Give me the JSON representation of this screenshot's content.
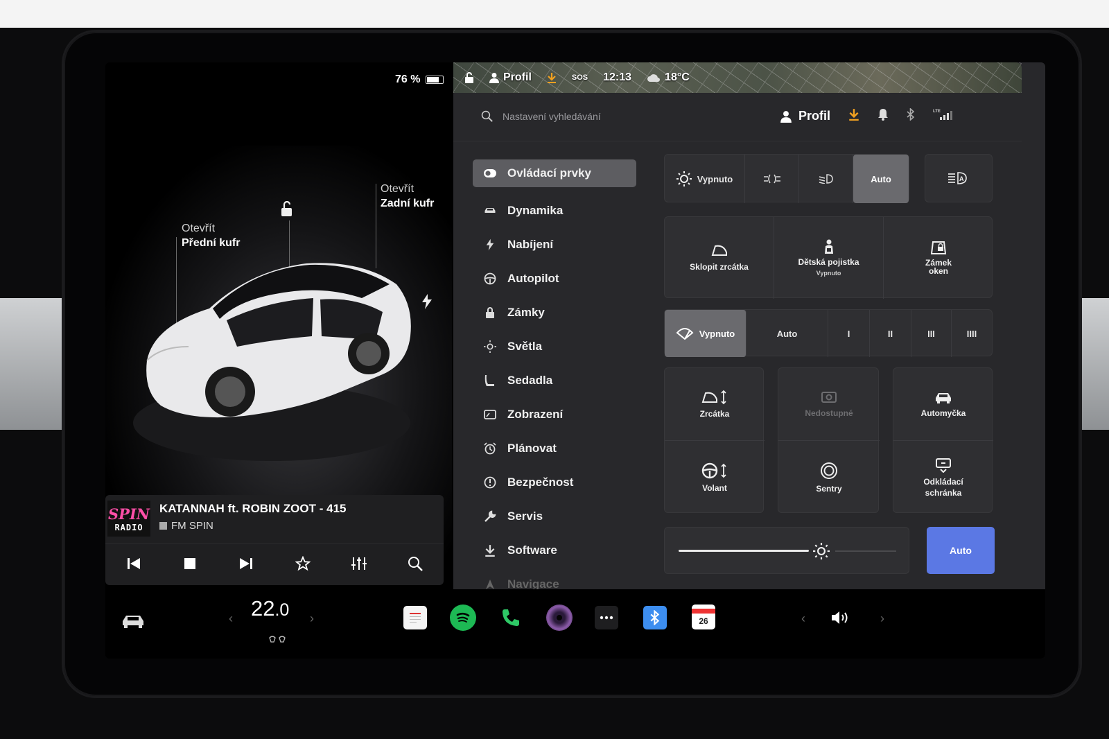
{
  "left": {
    "battery": "76 %",
    "battery_level": 0.76,
    "callout_front": {
      "line1": "Otevřít",
      "line2": "Přední kufr"
    },
    "callout_rear": {
      "line1": "Otevřít",
      "line2": "Zadní kufr"
    }
  },
  "media": {
    "logo_text": "SPIN",
    "logo_sub": "RADIO",
    "track": "KATANNAH ft. ROBIN ZOOT - 415",
    "station": "FM SPIN",
    "controls": [
      "prev-icon",
      "stop-icon",
      "next-icon",
      "favorite-icon",
      "equalizer-icon",
      "search-icon"
    ]
  },
  "statusbar": {
    "profile": "Profil",
    "sos": "SOS",
    "time": "12:13",
    "temperature": "18°C"
  },
  "topbar": {
    "search_placeholder": "Nastavení vyhledávání",
    "profile": "Profil"
  },
  "nav": {
    "items": [
      {
        "label": "Ovládací prvky",
        "icon": "toggle-icon",
        "active": true
      },
      {
        "label": "Dynamika",
        "icon": "car-icon"
      },
      {
        "label": "Nabíjení",
        "icon": "bolt-icon"
      },
      {
        "label": "Autopilot",
        "icon": "steering-wheel-icon"
      },
      {
        "label": "Zámky",
        "icon": "lock-icon"
      },
      {
        "label": "Světla",
        "icon": "sun-icon"
      },
      {
        "label": "Sedadla",
        "icon": "seat-icon"
      },
      {
        "label": "Zobrazení",
        "icon": "display-icon"
      },
      {
        "label": "Plánovat",
        "icon": "alarm-clock-icon"
      },
      {
        "label": "Bezpečnost",
        "icon": "info-circle-icon"
      },
      {
        "label": "Servis",
        "icon": "wrench-icon"
      },
      {
        "label": "Software",
        "icon": "download-icon"
      },
      {
        "label": "Navigace",
        "icon": "navigation-icon",
        "dim": true
      }
    ]
  },
  "lights": {
    "off": "Vypnuto",
    "auto": "Auto",
    "selected": "Auto"
  },
  "quick": {
    "fold_mirrors": "Sklopit zrcátka",
    "child_lock": "Dětská pojistka",
    "child_lock_state": "Vypnuto",
    "window_lock_1": "Zámek",
    "window_lock_2": "oken"
  },
  "wipers": {
    "off": "Vypnuto",
    "auto": "Auto",
    "speeds": [
      "I",
      "II",
      "III",
      "IIII"
    ],
    "selected": "Vypnuto"
  },
  "tiles": {
    "mirrors": "Zrcátka",
    "unavailable": "Nedostupné",
    "carwash": "Automyčka",
    "wheel": "Volant",
    "sentry": "Sentry",
    "glovebox_1": "Odkládací",
    "glovebox_2": "schránka"
  },
  "brightness": {
    "level": 0.6,
    "auto": "Auto"
  },
  "dock": {
    "temperature_whole": "22",
    "temperature_decimal": ".0",
    "calendar_day": "26",
    "accent_blue": "#5b78e4",
    "spotify_green": "#1db954",
    "phone_green": "#2ec866",
    "bluetooth_blue": "#3d8ef0"
  }
}
